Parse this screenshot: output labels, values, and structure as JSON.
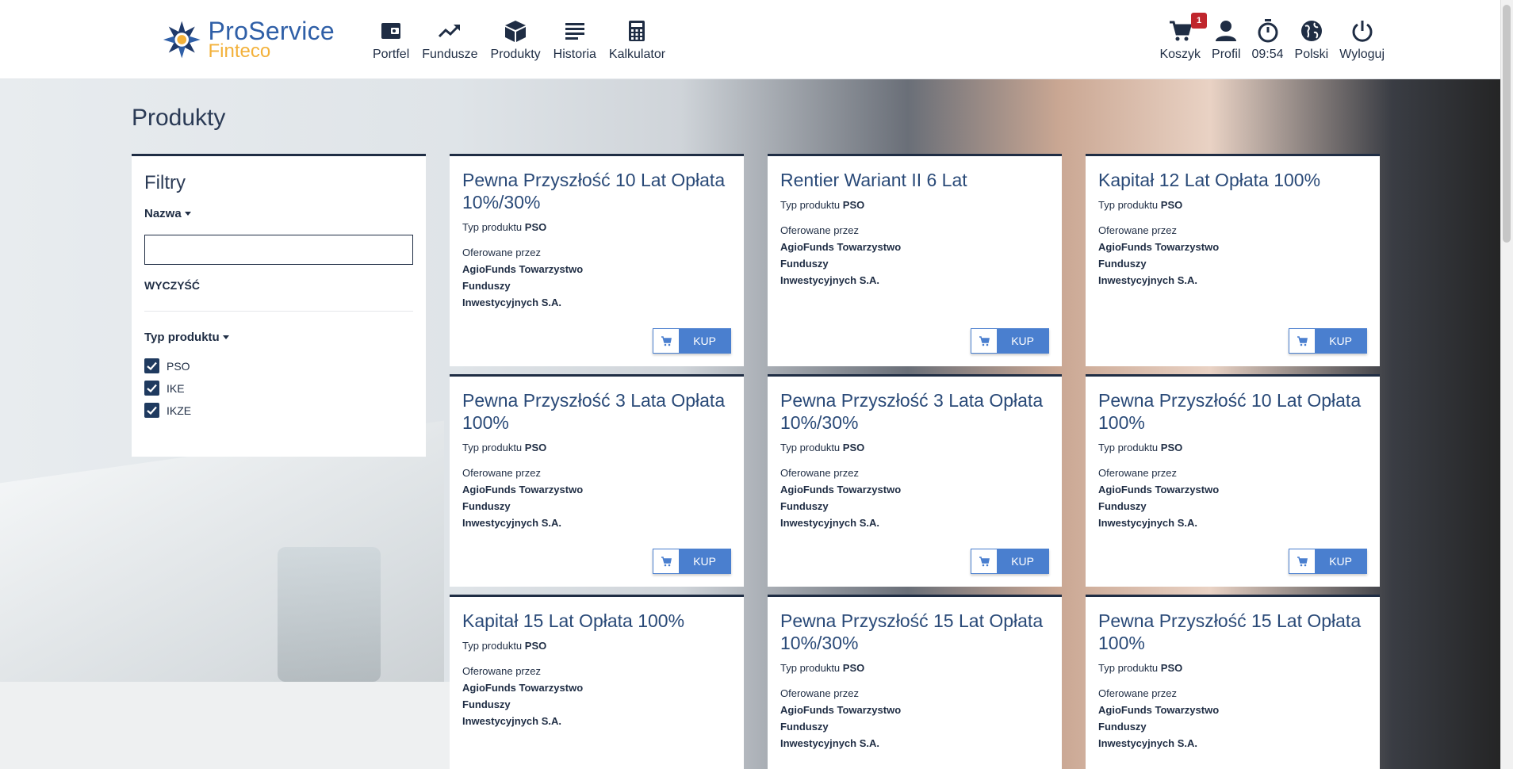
{
  "app": {
    "brand_line1": "ProService",
    "brand_line2": "Finteco"
  },
  "nav": {
    "left": [
      {
        "label": "Portfel",
        "icon": "wallet-icon"
      },
      {
        "label": "Fundusze",
        "icon": "trending-up-icon"
      },
      {
        "label": "Produkty",
        "icon": "box-icon"
      },
      {
        "label": "Historia",
        "icon": "list-icon"
      },
      {
        "label": "Kalkulator",
        "icon": "calculator-icon"
      }
    ],
    "right": [
      {
        "label": "Koszyk",
        "icon": "cart-icon",
        "badge": "1"
      },
      {
        "label": "Profil",
        "icon": "user-icon"
      },
      {
        "label": "09:54",
        "icon": "timer-icon"
      },
      {
        "label": "Polski",
        "icon": "globe-icon"
      },
      {
        "label": "Wyloguj",
        "icon": "power-icon"
      }
    ]
  },
  "page": {
    "title": "Produkty"
  },
  "filters": {
    "title": "Filtry",
    "name_label": "Nazwa",
    "name_value": "",
    "clear_label": "WYCZYŚĆ",
    "type_label": "Typ produktu",
    "types": [
      {
        "label": "PSO",
        "checked": true
      },
      {
        "label": "IKE",
        "checked": true
      },
      {
        "label": "IKZE",
        "checked": true
      }
    ]
  },
  "card_labels": {
    "type_prefix": "Typ produktu",
    "offered_by": "Oferowane przez",
    "buy": "KUP"
  },
  "products": [
    {
      "title": "Pewna Przyszłość 10 Lat Opłata 10%/30%",
      "type": "PSO",
      "provider_l1": "AgioFunds Towarzystwo",
      "provider_l2": "Funduszy",
      "provider_l3": "Inwestycyjnych S.A."
    },
    {
      "title": "Rentier Wariant II 6 Lat",
      "type": "PSO",
      "provider_l1": "AgioFunds Towarzystwo",
      "provider_l2": "Funduszy",
      "provider_l3": "Inwestycyjnych S.A."
    },
    {
      "title": "Kapitał 12 Lat Opłata 100%",
      "type": "PSO",
      "provider_l1": "AgioFunds Towarzystwo",
      "provider_l2": "Funduszy",
      "provider_l3": "Inwestycyjnych S.A."
    },
    {
      "title": "Pewna Przyszłość 3 Lata Opłata 100%",
      "type": "PSO",
      "provider_l1": "AgioFunds Towarzystwo",
      "provider_l2": "Funduszy",
      "provider_l3": "Inwestycyjnych S.A."
    },
    {
      "title": "Pewna Przyszłość 3 Lata Opłata 10%/30%",
      "type": "PSO",
      "provider_l1": "AgioFunds Towarzystwo",
      "provider_l2": "Funduszy",
      "provider_l3": "Inwestycyjnych S.A."
    },
    {
      "title": "Pewna Przyszłość 10 Lat Opłata 100%",
      "type": "PSO",
      "provider_l1": "AgioFunds Towarzystwo",
      "provider_l2": "Funduszy",
      "provider_l3": "Inwestycyjnych S.A."
    },
    {
      "title": "Kapitał 15 Lat Opłata 100%",
      "type": "PSO",
      "provider_l1": "AgioFunds Towarzystwo",
      "provider_l2": "Funduszy",
      "provider_l3": "Inwestycyjnych S.A."
    },
    {
      "title": "Pewna Przyszłość 15 Lat Opłata 10%/30%",
      "type": "PSO",
      "provider_l1": "AgioFunds Towarzystwo",
      "provider_l2": "Funduszy",
      "provider_l3": "Inwestycyjnych S.A."
    },
    {
      "title": "Pewna Przyszłość 15 Lat Opłata 100%",
      "type": "PSO",
      "provider_l1": "AgioFunds Towarzystwo",
      "provider_l2": "Funduszy",
      "provider_l3": "Inwestycyjnych S.A."
    }
  ],
  "colors": {
    "brand_blue": "#2f5fa7",
    "brand_yellow": "#f3b13a",
    "navy": "#1f2d44",
    "buy_blue": "#4a7fcf",
    "badge_red": "#c0262d"
  }
}
